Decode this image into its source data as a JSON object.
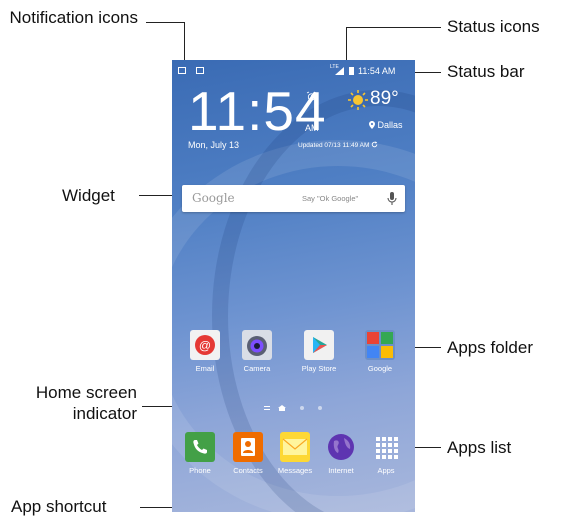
{
  "callouts": {
    "notification_icons": "Notification icons",
    "status_icons": "Status icons",
    "status_bar": "Status bar",
    "widget": "Widget",
    "apps_folder": "Apps folder",
    "home_screen_indicator": "Home screen indicator",
    "apps_list": "Apps list",
    "app_shortcut": "App shortcut"
  },
  "status_bar": {
    "network": "LTE",
    "time": "11:54 AM"
  },
  "widget": {
    "time": "11:54",
    "ampm": "AM",
    "date": "Mon, July 13",
    "temperature": "89°",
    "city": "Dallas",
    "updated": "Updated 07/13 11:49 AM"
  },
  "search": {
    "logo": "Google",
    "hint": "Say \"Ok Google\""
  },
  "apps": [
    "Email",
    "Camera",
    "Play Store",
    "Google"
  ],
  "dock": [
    "Phone",
    "Contacts",
    "Messages",
    "Internet",
    "Apps"
  ],
  "colors": {
    "wallpaper": "#4f7fc4",
    "leader": "#222222"
  },
  "icons": [
    "calendar-icon",
    "image-icon",
    "signal-icon",
    "battery-icon",
    "alarm-icon",
    "sun-icon",
    "location-pin-icon",
    "refresh-icon",
    "microphone-icon"
  ]
}
